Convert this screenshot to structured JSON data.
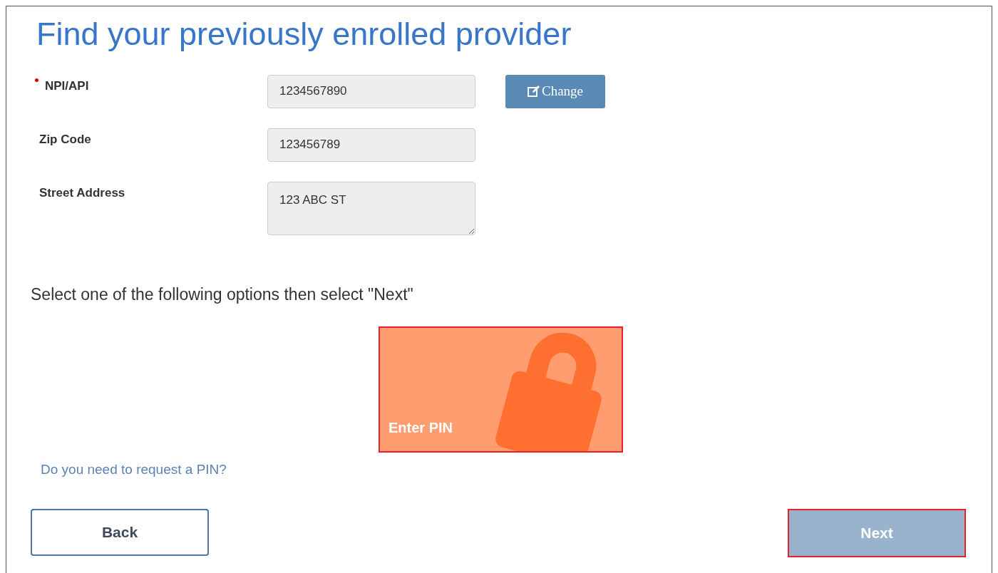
{
  "title": "Find your previously enrolled provider",
  "fields": [
    {
      "label": "NPI/API",
      "required": true,
      "value": "1234567890",
      "kind": "input",
      "action": "Change"
    },
    {
      "label": "Zip Code",
      "required": false,
      "value": "123456789",
      "kind": "input"
    },
    {
      "label": "Street Address",
      "required": false,
      "value": "123 ABC ST",
      "kind": "textarea"
    }
  ],
  "instruction": "Select one of the following options then select \"Next\"",
  "options": [
    {
      "label": "Enter PIN",
      "highlighted": true
    }
  ],
  "request_link": "Do you need to request a PIN?",
  "buttons": {
    "back": {
      "label": "Back"
    },
    "next": {
      "label": "Next",
      "disabled": true,
      "highlighted": true
    }
  }
}
